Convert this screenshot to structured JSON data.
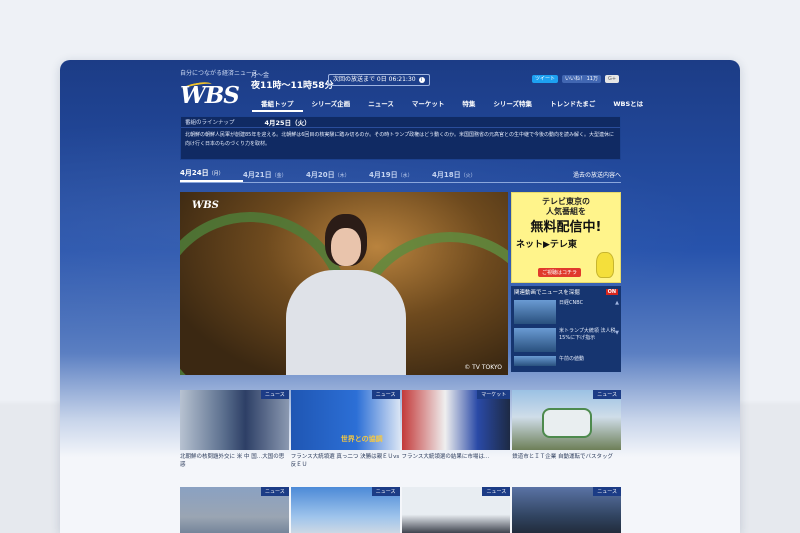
{
  "header": {
    "tagline": "自分につながる経済ニュース",
    "airtime_days": "月～金",
    "airtime_time": "夜11時～11時58分",
    "countdown": "次回の放送まで 0日 06:21:30",
    "logo": "WBS",
    "social": {
      "tweet": "ツイート",
      "like": "いいね！ 11万",
      "gplus": "G+"
    }
  },
  "nav": {
    "items": [
      "番組トップ",
      "シリーズ企画",
      "ニュース",
      "マーケット",
      "特集",
      "シリーズ特集",
      "トレンドたまご",
      "WBSとは"
    ],
    "active_index": 0
  },
  "lineup": {
    "label": "番組のラインナップ",
    "date": "4月25日（火）",
    "text": "北朝鮮の朝鮮人民軍が創建85年を迎える。北朝鮮は6回目の核実験に踏み切るのか。その時トランプ政権はどう動くのか。米国国務省の元高官との生中継で今後の動向を読み解く。大型連休に向け行く日本のものづくり力を取材。"
  },
  "dates": {
    "tabs": [
      {
        "date": "4月24日",
        "dow": "（月）"
      },
      {
        "date": "4月21日",
        "dow": "（金）"
      },
      {
        "date": "4月20日",
        "dow": "（木）"
      },
      {
        "date": "4月19日",
        "dow": "（水）"
      },
      {
        "date": "4月18日",
        "dow": "（火）"
      }
    ],
    "active_index": 0,
    "past_link": "過去の放送内容へ"
  },
  "video": {
    "bug": "WBS",
    "copyright": "© TV TOKYO"
  },
  "ad": {
    "line1": "テレビ東京の",
    "line2": "人気番組を",
    "line3": "無料配信中!",
    "line4": "ネット▶テレ東",
    "button": "ご視聴はコチラ"
  },
  "related": {
    "title": "関連動画でニュースを深掘",
    "on_badge": "ON",
    "items": [
      {
        "text": "日経CNBC"
      },
      {
        "text": "米トランプ大統領 法人税15%に下げ指示"
      },
      {
        "text": "午前の値動"
      }
    ]
  },
  "news": [
    {
      "tag": "ニュース",
      "title": "北朝鮮の核問題外交に 米 中 国…大国の思惑"
    },
    {
      "tag": "ニュース",
      "title": "フランス大統領選 真っ二つ 決勝は親ＥＵvs反ＥＵ",
      "overlay": "世界との協調"
    },
    {
      "tag": "マーケット",
      "title": "フランス大統領選の結果に市場は…"
    },
    {
      "tag": "ニュース",
      "title": "鉄道市とＩＴ企業 自動運転でバスタッグ"
    },
    {
      "tag": "ニュース",
      "title": ""
    },
    {
      "tag": "ニュース",
      "title": ""
    },
    {
      "tag": "ニュース",
      "title": ""
    },
    {
      "tag": "ニュース",
      "title": ""
    }
  ]
}
